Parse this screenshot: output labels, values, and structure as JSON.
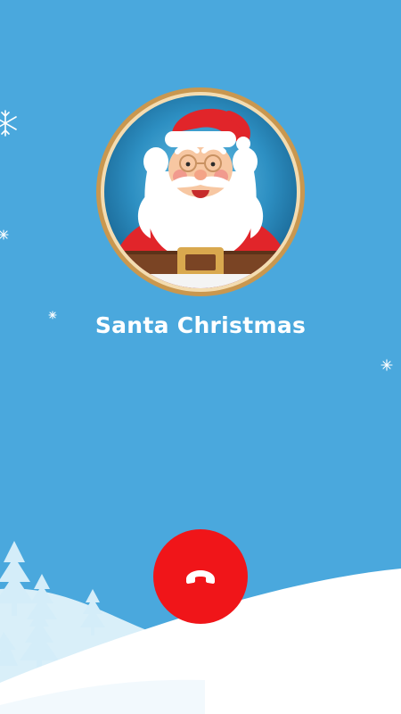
{
  "call": {
    "caller_name": "Santa Christmas"
  },
  "icons": {
    "end_call": "phone-hangup-icon",
    "avatar": "santa-claus-avatar",
    "decor": "snowflake-icon"
  },
  "colors": {
    "background": "#4aa8dd",
    "end_call_button": "#f01519",
    "avatar_frame": "#c9974f",
    "snow": "#ffffff",
    "trees": "#d6eefa"
  }
}
